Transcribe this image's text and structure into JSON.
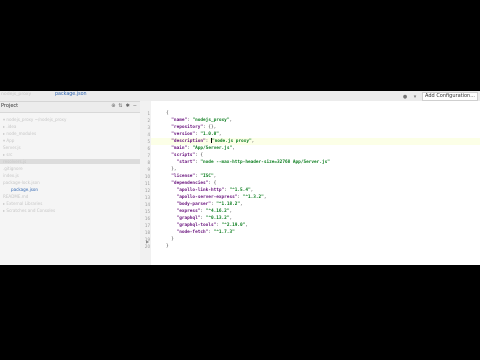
{
  "breadcrumb": {
    "project": "nodejs_proxy",
    "file": "package.json"
  },
  "toolbar": {
    "project_label": "Project",
    "add_configuration": "Add Configuration..."
  },
  "sidebar": {
    "items": [
      {
        "label": "▾ nodejs_proxy ~/nodejs_proxy",
        "type": "folder"
      },
      {
        "label": "▸ .idea",
        "type": "folder"
      },
      {
        "label": "▸ node_modules",
        "type": "folder"
      },
      {
        "label": "▾ App",
        "type": "folder"
      },
      {
        "label": "  Server.js",
        "type": "file"
      },
      {
        "label": "▸ src",
        "type": "folder"
      },
      {
        "label": "  resolvers.js",
        "type": "file"
      },
      {
        "label": "  .gitignore",
        "type": "file"
      },
      {
        "label": "  index.js",
        "type": "file"
      },
      {
        "label": "  package-lock.json",
        "type": "file"
      },
      {
        "label": "package.json",
        "type": "current"
      },
      {
        "label": "  README.md",
        "type": "file"
      },
      {
        "label": "▸ External Libraries",
        "type": "folder"
      },
      {
        "label": "▸ Scratches and Consoles",
        "type": "folder"
      }
    ]
  },
  "code": {
    "lines": [
      {
        "no": "1",
        "parts": [
          {
            "t": "{",
            "c": "punct"
          }
        ]
      },
      {
        "no": "2",
        "parts": [
          {
            "t": "  \"name\"",
            "c": "key"
          },
          {
            "t": ": ",
            "c": "punct"
          },
          {
            "t": "\"nodejs_proxy\"",
            "c": "str"
          },
          {
            "t": ",",
            "c": "punct"
          }
        ]
      },
      {
        "no": "3",
        "parts": [
          {
            "t": "  \"repository\"",
            "c": "key"
          },
          {
            "t": ": {},",
            "c": "punct"
          }
        ]
      },
      {
        "no": "4",
        "parts": [
          {
            "t": "  \"version\"",
            "c": "key"
          },
          {
            "t": ": ",
            "c": "punct"
          },
          {
            "t": "\"1.0.0\"",
            "c": "str"
          },
          {
            "t": ",",
            "c": "punct"
          }
        ]
      },
      {
        "no": "5",
        "parts": [
          {
            "t": "  \"description\"",
            "c": "key"
          },
          {
            "t": ": ",
            "c": "punct"
          },
          {
            "t": "\"node.js proxy\"",
            "c": "str"
          },
          {
            "t": ",",
            "c": "punct"
          }
        ]
      },
      {
        "no": "6",
        "parts": [
          {
            "t": "  \"main\"",
            "c": "key"
          },
          {
            "t": ": ",
            "c": "punct"
          },
          {
            "t": "\"App/Server.js\"",
            "c": "str"
          },
          {
            "t": ",",
            "c": "punct"
          }
        ]
      },
      {
        "no": "7",
        "parts": [
          {
            "t": "  \"scripts\"",
            "c": "key"
          },
          {
            "t": ": {",
            "c": "punct"
          }
        ]
      },
      {
        "no": "8",
        "parts": [
          {
            "t": "    \"start\"",
            "c": "key"
          },
          {
            "t": ": ",
            "c": "punct"
          },
          {
            "t": "\"node --max-http-header-size=32768 App/Server.js\"",
            "c": "str"
          }
        ]
      },
      {
        "no": "9",
        "parts": [
          {
            "t": "  },",
            "c": "punct"
          }
        ]
      },
      {
        "no": "10",
        "parts": [
          {
            "t": "  \"license\"",
            "c": "key"
          },
          {
            "t": ": ",
            "c": "punct"
          },
          {
            "t": "\"ISC\"",
            "c": "str"
          },
          {
            "t": ",",
            "c": "punct"
          }
        ]
      },
      {
        "no": "11",
        "parts": [
          {
            "t": "  \"dependencies\"",
            "c": "key"
          },
          {
            "t": ": {",
            "c": "punct"
          }
        ]
      },
      {
        "no": "12",
        "parts": [
          {
            "t": "    \"apollo-link-http\"",
            "c": "key"
          },
          {
            "t": ": ",
            "c": "punct"
          },
          {
            "t": "\"^1.5.4\"",
            "c": "str"
          },
          {
            "t": ",",
            "c": "punct"
          }
        ]
      },
      {
        "no": "13",
        "parts": [
          {
            "t": "    \"apollo-server-express\"",
            "c": "key"
          },
          {
            "t": ": ",
            "c": "punct"
          },
          {
            "t": "\"^1.3.2\"",
            "c": "str"
          },
          {
            "t": ",",
            "c": "punct"
          }
        ]
      },
      {
        "no": "14",
        "parts": [
          {
            "t": "    \"body-parser\"",
            "c": "key"
          },
          {
            "t": ": ",
            "c": "punct"
          },
          {
            "t": "\"^1.18.2\"",
            "c": "str"
          },
          {
            "t": ",",
            "c": "punct"
          }
        ]
      },
      {
        "no": "15",
        "parts": [
          {
            "t": "    \"express\"",
            "c": "key"
          },
          {
            "t": ": ",
            "c": "punct"
          },
          {
            "t": "\"^4.16.2\"",
            "c": "str"
          },
          {
            "t": ",",
            "c": "punct"
          }
        ]
      },
      {
        "no": "16",
        "parts": [
          {
            "t": "    \"graphql\"",
            "c": "key"
          },
          {
            "t": ": ",
            "c": "punct"
          },
          {
            "t": "\"^0.13.2\"",
            "c": "str"
          },
          {
            "t": ",",
            "c": "punct"
          }
        ]
      },
      {
        "no": "17",
        "parts": [
          {
            "t": "    \"graphql-tools\"",
            "c": "key"
          },
          {
            "t": ": ",
            "c": "punct"
          },
          {
            "t": "\"^2.19.0\"",
            "c": "str"
          },
          {
            "t": ",",
            "c": "punct"
          }
        ]
      },
      {
        "no": "18",
        "parts": [
          {
            "t": "    \"node-fetch\"",
            "c": "key"
          },
          {
            "t": ": ",
            "c": "punct"
          },
          {
            "t": "\"^1.7.3\"",
            "c": "str"
          }
        ]
      },
      {
        "no": "19",
        "parts": [
          {
            "t": "  }",
            "c": "punct"
          }
        ]
      },
      {
        "no": "20",
        "parts": [
          {
            "t": "}",
            "c": "punct"
          }
        ]
      }
    ]
  }
}
